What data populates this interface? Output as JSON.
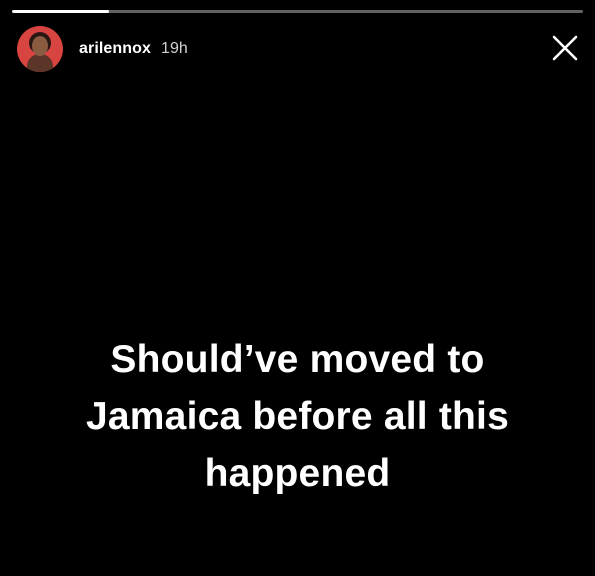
{
  "story": {
    "progress_fraction": 0.17,
    "user": {
      "username": "arilennox",
      "time_ago": "19h"
    },
    "close_icon": "close-icon",
    "avatar_icon": "avatar",
    "caption_lines": [
      "Should’ve moved to",
      "Jamaica before all this",
      "happened"
    ]
  },
  "colors": {
    "background": "#000000",
    "text": "#ffffff",
    "avatar_bg": "#d8443f"
  }
}
